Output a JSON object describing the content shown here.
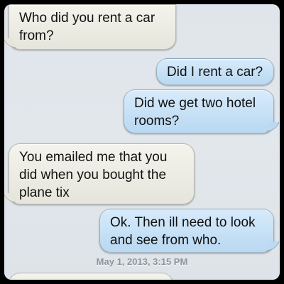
{
  "messages": [
    {
      "id": "m1",
      "direction": "incoming",
      "text": "Who did you rent a car from?"
    },
    {
      "id": "m2",
      "direction": "outgoing",
      "text": "Did I rent a car?"
    },
    {
      "id": "m3",
      "direction": "outgoing",
      "text": "Did we get two hotel rooms?"
    },
    {
      "id": "m4",
      "direction": "incoming",
      "text": "You emailed me that you did when you bought the plane tix"
    },
    {
      "id": "m5",
      "direction": "outgoing",
      "text": "Ok. Then ill need to look and see from who."
    }
  ],
  "timestamp": "May 1, 2013, 3:15 PM",
  "colors": {
    "incoming_bubble": "#eceae2",
    "outgoing_bubble": "#c6e0f5",
    "background": "#e0e6eb",
    "timestamp_text": "#8e949b"
  }
}
